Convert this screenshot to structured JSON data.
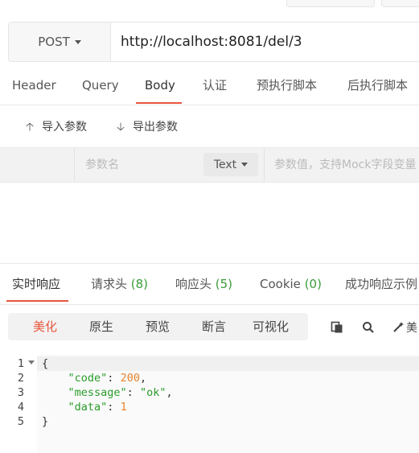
{
  "request": {
    "method": "POST",
    "url": "http://localhost:8081/del/3"
  },
  "request_tabs": [
    "Header",
    "Query",
    "Body",
    "认证",
    "预执行脚本",
    "后执行脚本"
  ],
  "active_request_tab": "Body",
  "body_actions": {
    "import_label": "导入参数",
    "export_label": "导出参数"
  },
  "param_row": {
    "name_placeholder": "参数名",
    "type": "Text",
    "value_placeholder": "参数值，支持Mock字段变量"
  },
  "response_tabs": [
    {
      "label": "实时响应",
      "count": ""
    },
    {
      "label": "请求头 ",
      "count": "(8)"
    },
    {
      "label": "响应头 ",
      "count": "(5)"
    },
    {
      "label": "Cookie ",
      "count": "(0)"
    },
    {
      "label": "成功响应示例",
      "count": ""
    }
  ],
  "view_modes": [
    "美化",
    "原生",
    "预览",
    "断言",
    "可视化"
  ],
  "active_view_mode": "美化",
  "tools": {
    "beautify_label": "美"
  },
  "code": {
    "line_numbers": [
      "1",
      "2",
      "3",
      "4",
      "5"
    ],
    "open_brace": "{",
    "close_brace": "}",
    "fields": [
      {
        "key": "\"code\"",
        "value": "200",
        "type": "number",
        "trail": ","
      },
      {
        "key": "\"message\"",
        "value": "\"ok\"",
        "type": "string",
        "trail": ","
      },
      {
        "key": "\"data\"",
        "value": "1",
        "type": "number",
        "trail": ""
      }
    ]
  },
  "colors": {
    "accent": "#e8563f",
    "count_green": "#3a9b3a",
    "json_key": "#2a9d2a",
    "json_number": "#e8822d"
  }
}
